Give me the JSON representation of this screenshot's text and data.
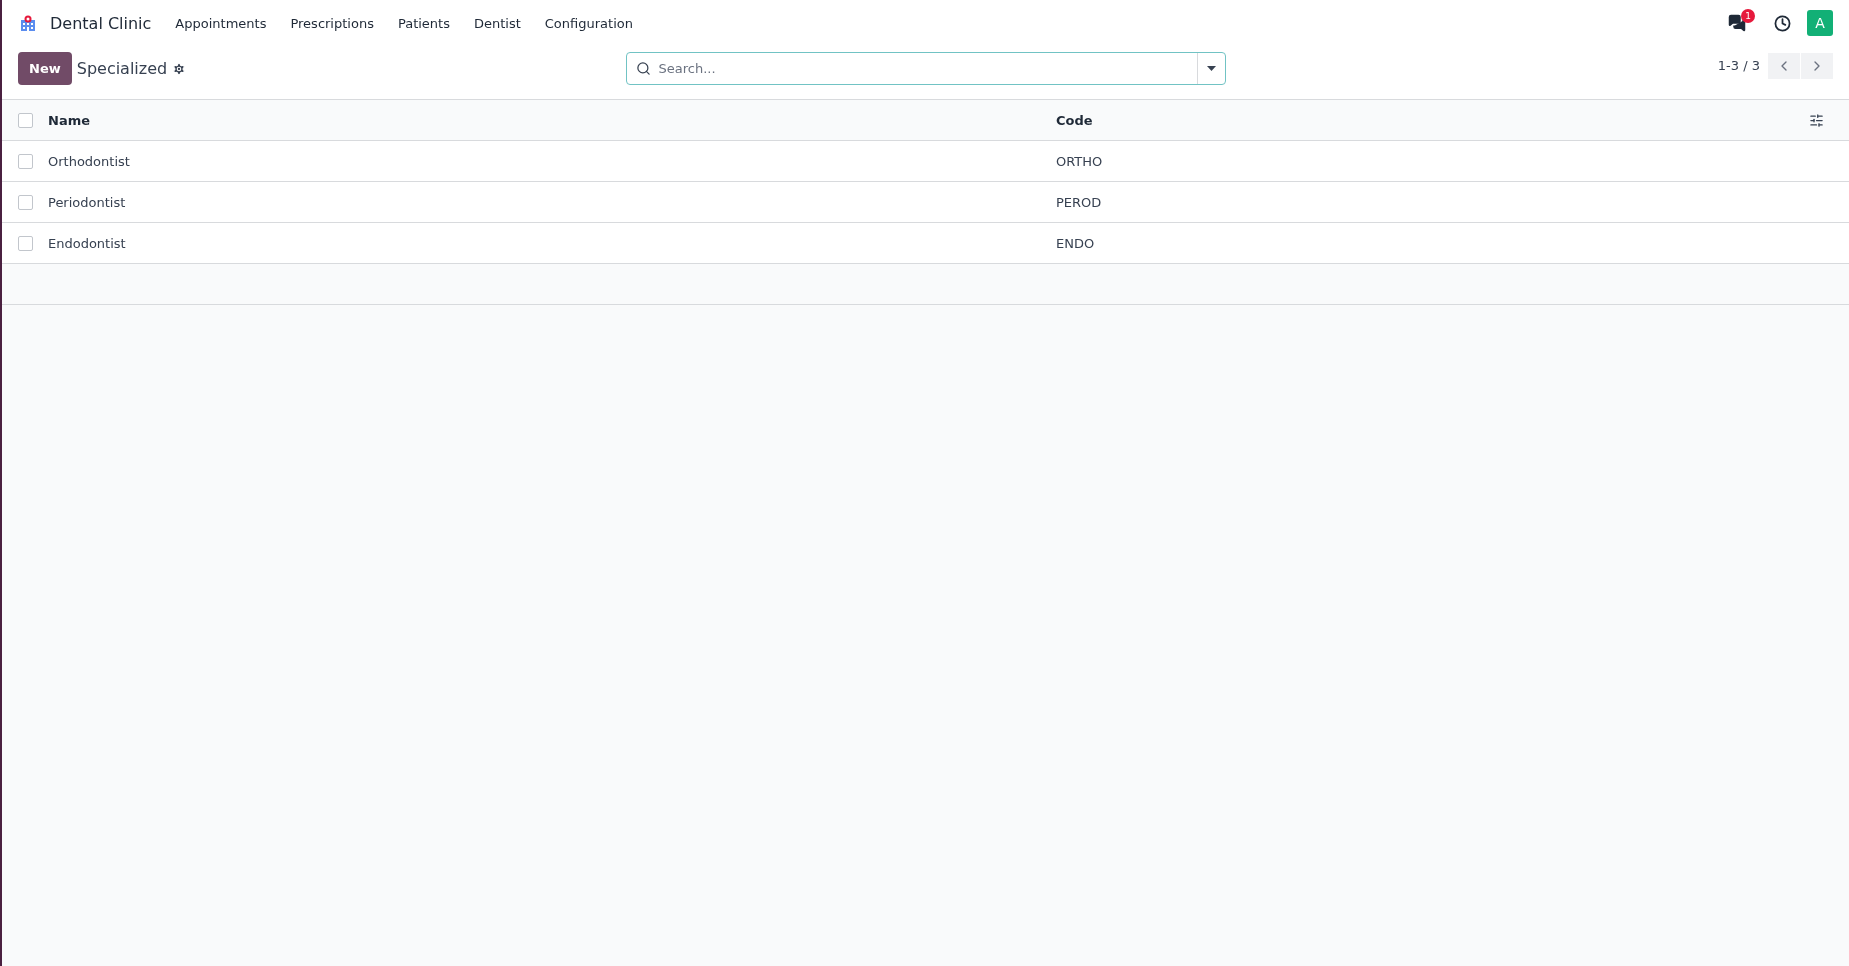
{
  "navbar": {
    "app_name": "Dental Clinic",
    "menu": [
      "Appointments",
      "Prescriptions",
      "Patients",
      "Dentist",
      "Configuration"
    ],
    "message_count": "1",
    "avatar_letter": "A"
  },
  "control_panel": {
    "new_button": "New",
    "title": "Specialized",
    "search": {
      "placeholder": "Search..."
    },
    "pager": "1-3 / 3"
  },
  "table": {
    "select_all_checked": false,
    "columns": [
      "Name",
      "Code"
    ],
    "rows": [
      {
        "name": "Orthodontist",
        "code": "ORTHO",
        "checked": false
      },
      {
        "name": "Periodontist",
        "code": "PEROD",
        "checked": false
      },
      {
        "name": "Endodontist",
        "code": "ENDO",
        "checked": false
      }
    ]
  }
}
